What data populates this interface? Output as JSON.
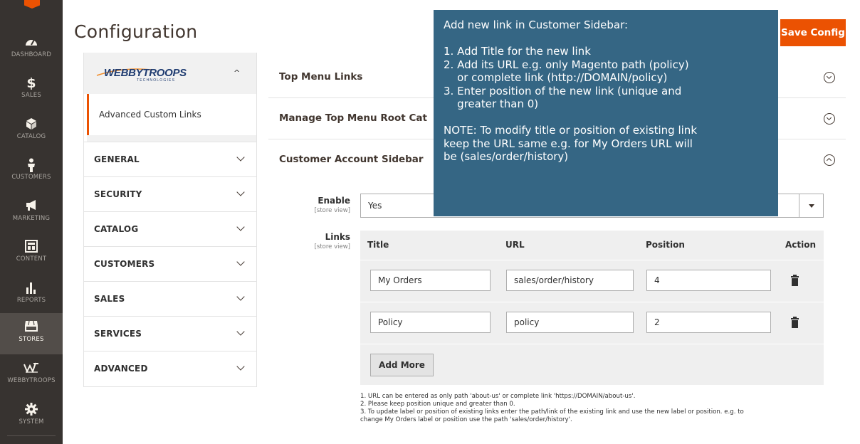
{
  "nav": {
    "items": [
      {
        "label": "DASHBOARD",
        "icon": "gauge-icon"
      },
      {
        "label": "SALES",
        "icon": "dollar-icon"
      },
      {
        "label": "CATALOG",
        "icon": "box-icon"
      },
      {
        "label": "CUSTOMERS",
        "icon": "person-icon"
      },
      {
        "label": "MARKETING",
        "icon": "megaphone-icon"
      },
      {
        "label": "CONTENT",
        "icon": "layout-icon"
      },
      {
        "label": "REPORTS",
        "icon": "bar-chart-icon"
      },
      {
        "label": "STORES",
        "icon": "store-icon"
      },
      {
        "label": "WEBBYTROOPS",
        "icon": "webbytroops-icon"
      },
      {
        "label": "SYSTEM",
        "icon": "gear-icon"
      }
    ],
    "active": "STORES"
  },
  "header": {
    "title": "Configuration",
    "save_label": "Save Config"
  },
  "tabs": {
    "brand": "WEBBYTROOPS",
    "brand_sub": "TECHNOLOGIES",
    "active_item": "Advanced Custom Links",
    "groups": [
      "GENERAL",
      "SECURITY",
      "CATALOG",
      "CUSTOMERS",
      "SALES",
      "SERVICES",
      "ADVANCED"
    ]
  },
  "sections": [
    {
      "title": "Top Menu Links",
      "state": "collapsed"
    },
    {
      "title": "Manage Top Menu Root Cat",
      "state": "collapsed"
    },
    {
      "title": "Customer Account Sidebar",
      "state": "expanded"
    }
  ],
  "form": {
    "enable_label": "Enable",
    "enable_scope": "[store view]",
    "enable_value": "Yes",
    "links_label": "Links",
    "links_scope": "[store view]",
    "columns": [
      "Title",
      "URL",
      "Position",
      "Action"
    ],
    "rows": [
      {
        "title": "My Orders",
        "url": "sales/order/history",
        "position": "4"
      },
      {
        "title": "Policy",
        "url": "policy",
        "position": "2"
      }
    ],
    "add_more_label": "Add More"
  },
  "notes": [
    "1. URL can be entered as only path 'about-us' or complete link 'https://DOMAIN/about-us'.",
    "2. Please keep position unique and greater than 0.",
    "3. To update label or position of existing links enter the path/link of the existing link and use the new label or position. e.g. to",
    "change My Orders label or position use the path 'sales/order/history'."
  ],
  "tooltip": {
    "lines": [
      "Add new link in Customer Sidebar:",
      "",
      "1. Add Title for the new link",
      "2. Add its URL e.g. only Magento path (policy)",
      "    or complete link (http://DOMAIN/policy)",
      "3. Enter position of the new link (unique and",
      "    greater than 0)",
      "",
      "NOTE: To modify title or position of existing link",
      "keep the URL same e.g. for My Orders URL will",
      "be (sales/order/history)"
    ]
  },
  "colors": {
    "accent": "#eb5202",
    "nav_bg": "#373330",
    "tooltip_bg": "#356684"
  }
}
